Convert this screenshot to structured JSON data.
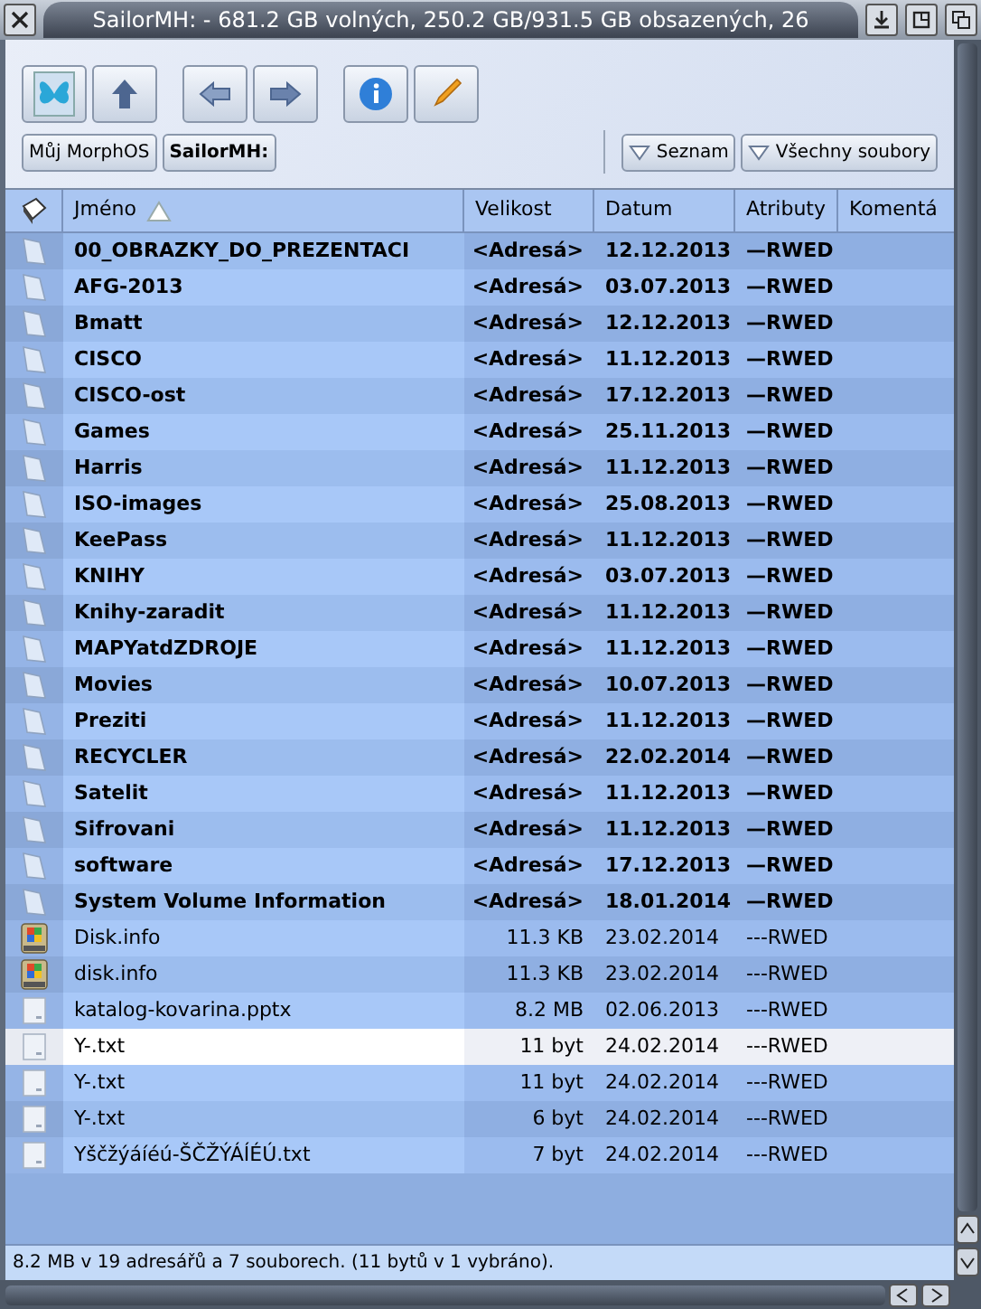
{
  "window": {
    "title": "SailorMH: - 681.2 GB volných, 250.2 GB/931.5 GB obsazených, 26"
  },
  "path_buttons": [
    {
      "label": "Můj MorphOS",
      "bold": false
    },
    {
      "label": "SailorMH:",
      "bold": true
    }
  ],
  "view_buttons": [
    "Seznam",
    "Všechny soubory"
  ],
  "table": {
    "columns": [
      "Jméno",
      "Velikost",
      "Datum",
      "Atributy",
      "Komentá"
    ],
    "rows": [
      {
        "kind": "dir",
        "name": "00_OBRAZKY_DO_PREZENTACI",
        "size": "<Adresá>",
        "date": "12.12.2013",
        "attr": "—RWED",
        "selected": false
      },
      {
        "kind": "dir",
        "name": "AFG-2013",
        "size": "<Adresá>",
        "date": "03.07.2013",
        "attr": "—RWED",
        "selected": false
      },
      {
        "kind": "dir",
        "name": "Bmatt",
        "size": "<Adresá>",
        "date": "12.12.2013",
        "attr": "—RWED",
        "selected": false
      },
      {
        "kind": "dir",
        "name": "CISCO",
        "size": "<Adresá>",
        "date": "11.12.2013",
        "attr": "—RWED",
        "selected": false
      },
      {
        "kind": "dir",
        "name": "CISCO-ost",
        "size": "<Adresá>",
        "date": "17.12.2013",
        "attr": "—RWED",
        "selected": false
      },
      {
        "kind": "dir",
        "name": "Games",
        "size": "<Adresá>",
        "date": "25.11.2013",
        "attr": "—RWED",
        "selected": false
      },
      {
        "kind": "dir",
        "name": "Harris",
        "size": "<Adresá>",
        "date": "11.12.2013",
        "attr": "—RWED",
        "selected": false
      },
      {
        "kind": "dir",
        "name": "ISO-images",
        "size": "<Adresá>",
        "date": "25.08.2013",
        "attr": "—RWED",
        "selected": false
      },
      {
        "kind": "dir",
        "name": "KeePass",
        "size": "<Adresá>",
        "date": "11.12.2013",
        "attr": "—RWED",
        "selected": false
      },
      {
        "kind": "dir",
        "name": "KNIHY",
        "size": "<Adresá>",
        "date": "03.07.2013",
        "attr": "—RWED",
        "selected": false
      },
      {
        "kind": "dir",
        "name": "Knihy-zaradit",
        "size": "<Adresá>",
        "date": "11.12.2013",
        "attr": "—RWED",
        "selected": false
      },
      {
        "kind": "dir",
        "name": "MAPYatdZDROJE",
        "size": "<Adresá>",
        "date": "11.12.2013",
        "attr": "—RWED",
        "selected": false
      },
      {
        "kind": "dir",
        "name": "Movies",
        "size": "<Adresá>",
        "date": "10.07.2013",
        "attr": "—RWED",
        "selected": false
      },
      {
        "kind": "dir",
        "name": "Preziti",
        "size": "<Adresá>",
        "date": "11.12.2013",
        "attr": "—RWED",
        "selected": false
      },
      {
        "kind": "dir",
        "name": "RECYCLER",
        "size": "<Adresá>",
        "date": "22.02.2014",
        "attr": "—RWED",
        "selected": false
      },
      {
        "kind": "dir",
        "name": "Satelit",
        "size": "<Adresá>",
        "date": "11.12.2013",
        "attr": "—RWED",
        "selected": false
      },
      {
        "kind": "dir",
        "name": "Sifrovani",
        "size": "<Adresá>",
        "date": "11.12.2013",
        "attr": "—RWED",
        "selected": false
      },
      {
        "kind": "dir",
        "name": "software",
        "size": "<Adresá>",
        "date": "17.12.2013",
        "attr": "—RWED",
        "selected": false
      },
      {
        "kind": "dir",
        "name": "System Volume Information",
        "size": "<Adresá>",
        "date": "18.01.2014",
        "attr": "—RWED",
        "selected": false
      },
      {
        "kind": "info",
        "name": "Disk.info",
        "size": "11.3 KB",
        "date": "23.02.2014",
        "attr": "---RWED",
        "selected": false
      },
      {
        "kind": "info",
        "name": "disk.info",
        "size": "11.3 KB",
        "date": "23.02.2014",
        "attr": "---RWED",
        "selected": false
      },
      {
        "kind": "file",
        "name": "katalog-kovarina.pptx",
        "size": "8.2 MB",
        "date": "02.06.2013",
        "attr": "---RWED",
        "selected": false
      },
      {
        "kind": "file",
        "name": "Y-.txt",
        "size": "11 byt",
        "date": "24.02.2014",
        "attr": "---RWED",
        "selected": true
      },
      {
        "kind": "file",
        "name": "Y-.txt",
        "size": "11 byt",
        "date": "24.02.2014",
        "attr": "---RWED",
        "selected": false
      },
      {
        "kind": "file",
        "name": "Y-.txt",
        "size": "6 byt",
        "date": "24.02.2014",
        "attr": "---RWED",
        "selected": false
      },
      {
        "kind": "file",
        "name": "Yščžýáíéú-ŠČŽÝÁÍÉÚ.txt",
        "size": "7 byt",
        "date": "24.02.2014",
        "attr": "---RWED",
        "selected": false
      }
    ]
  },
  "status_bar": "8.2 MB v 19 adresářů a 7 souborech. (11 bytů v 1 vybráno)."
}
